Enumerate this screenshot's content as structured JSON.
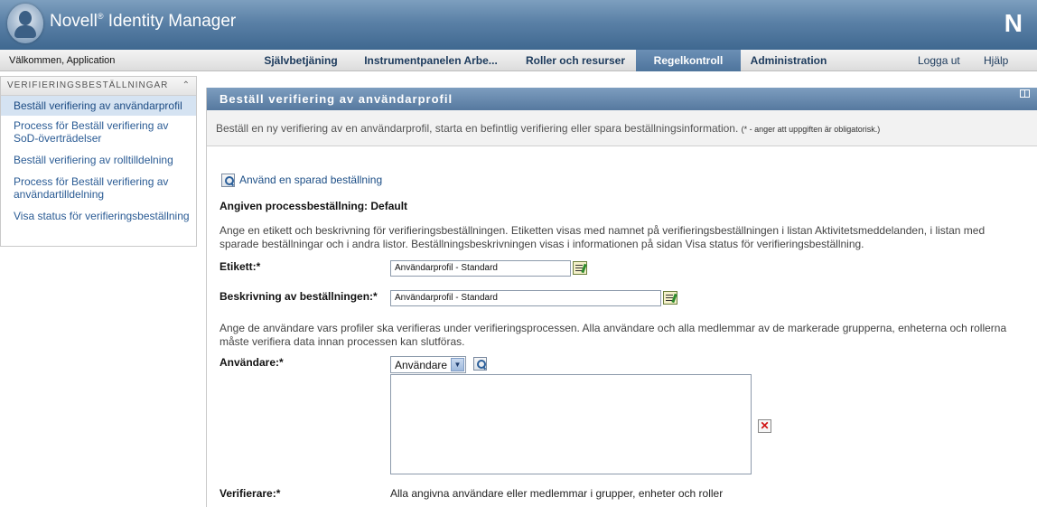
{
  "header": {
    "brand": "Novell",
    "brand_mark": "®",
    "product": "Identity Manager",
    "n_logo": "N"
  },
  "nav": {
    "welcome": "Välkommen, Application",
    "tabs": [
      "Självbetjäning",
      "Instrumentpanelen Arbe...",
      "Roller och resurser",
      "Regelkontroll",
      "Administration"
    ],
    "active_tab": "Regelkontroll",
    "logout": "Logga ut",
    "help": "Hjälp"
  },
  "sidebar": {
    "title": "VERIFIERINGSBESTÄLLNINGAR",
    "collapse_glyph": "⌃",
    "items": [
      {
        "label": "Beställ verifiering av användarprofil"
      },
      {
        "label": "Process för Beställ verifiering av SoD-överträdelser"
      },
      {
        "label": "Beställ verifiering av rolltilldelning"
      },
      {
        "label": "Process för Beställ verifiering av användartilldelning"
      },
      {
        "label": "Visa status för verifieringsbeställning"
      }
    ]
  },
  "panel": {
    "title": "Beställ verifiering av användarprofil",
    "intro": "Beställ en ny verifiering av en användarprofil, starta en befintlig verifiering eller spara beställningsinformation.",
    "intro_note": "(* - anger att uppgiften är obligatorisk.)"
  },
  "form": {
    "use_saved_link": "Använd en sparad beställning",
    "process_default": "Angiven processbeställning: Default",
    "label_help": "Ange en etikett och beskrivning för verifieringsbeställningen. Etiketten visas med namnet på verifieringsbeställningen i listan Aktivitetsmeddelanden, i listan med sparade beställningar och i andra listor. Beställningsbeskrivningen visas i informationen på sidan Visa status för verifieringsbeställning.",
    "etikett_label": "Etikett:*",
    "etikett_value": "Användarprofil - Standard",
    "beskrivning_label": "Beskrivning av beställningen:*",
    "beskrivning_value": "Användarprofil - Standard",
    "users_help": "Ange de användare vars profiler ska verifieras under verifieringsprocessen. Alla användare och alla medlemmar av de markerade grupperna, enheterna och rollerna måste verifiera data innan processen kan slutföras.",
    "anvandare_label": "Användare:*",
    "anvandare_select": "Användare",
    "verifierare_label": "Verifierare:*",
    "verifierare_value": "Alla angivna användare eller medlemmar i grupper, enheter och roller",
    "delete_glyph": "✕"
  },
  "colors": {
    "header_blue": "#5a80a6",
    "active_tab": "#4e749c",
    "link_blue": "#2a5b94",
    "sidebar_active": "#d5e3f2"
  }
}
